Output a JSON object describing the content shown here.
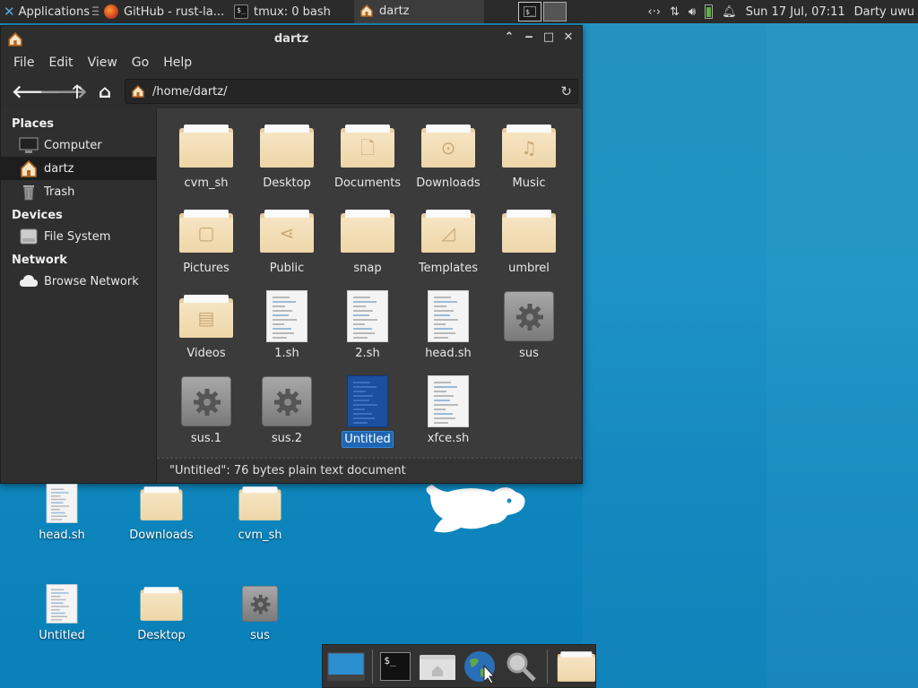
{
  "panel": {
    "apps_label": "Applications",
    "apps_sep": "☰",
    "tasks": [
      {
        "label": "GitHub - rust-la..."
      },
      {
        "label": "tmux: 0 bash"
      },
      {
        "label": "dartz"
      }
    ],
    "term_glyph": "$_",
    "clock": "Sun 17 Jul, 07:11",
    "user": "Darty uwu"
  },
  "window": {
    "title": "dartz",
    "menu": [
      "File",
      "Edit",
      "View",
      "Go",
      "Help"
    ],
    "path": "/home/dartz/",
    "sidebar": {
      "places_header": "Places",
      "places": [
        {
          "label": "Computer",
          "icon": "computer-icon"
        },
        {
          "label": "dartz",
          "icon": "home-icon"
        },
        {
          "label": "Trash",
          "icon": "trash-icon"
        }
      ],
      "devices_header": "Devices",
      "devices": [
        {
          "label": "File System",
          "icon": "drive-icon"
        }
      ],
      "network_header": "Network",
      "network": [
        {
          "label": "Browse Network",
          "icon": "cloud-icon"
        }
      ]
    },
    "files": [
      {
        "name": "cvm_sh",
        "type": "folder"
      },
      {
        "name": "Desktop",
        "type": "folder"
      },
      {
        "name": "Documents",
        "type": "folder",
        "emblem": "document"
      },
      {
        "name": "Downloads",
        "type": "folder",
        "emblem": "download"
      },
      {
        "name": "Music",
        "type": "folder",
        "emblem": "music"
      },
      {
        "name": "Pictures",
        "type": "folder",
        "emblem": "picture"
      },
      {
        "name": "Public",
        "type": "folder",
        "emblem": "share"
      },
      {
        "name": "snap",
        "type": "folder"
      },
      {
        "name": "Templates",
        "type": "folder",
        "emblem": "template"
      },
      {
        "name": "umbrel",
        "type": "folder"
      },
      {
        "name": "Videos",
        "type": "folder",
        "emblem": "video"
      },
      {
        "name": "1.sh",
        "type": "script"
      },
      {
        "name": "2.sh",
        "type": "script"
      },
      {
        "name": "head.sh",
        "type": "script"
      },
      {
        "name": "sus",
        "type": "executable"
      },
      {
        "name": "sus.1",
        "type": "executable"
      },
      {
        "name": "sus.2",
        "type": "executable"
      },
      {
        "name": "Untitled",
        "type": "text",
        "selected": true
      },
      {
        "name": "xfce.sh",
        "type": "script"
      }
    ],
    "status": "\"Untitled\": 76 bytes plain text document"
  },
  "desktop": {
    "icons": [
      {
        "name": "head.sh",
        "type": "script"
      },
      {
        "name": "Downloads",
        "type": "folder"
      },
      {
        "name": "cvm_sh",
        "type": "folder"
      },
      {
        "name": "Untitled",
        "type": "text"
      },
      {
        "name": "Desktop",
        "type": "folder"
      },
      {
        "name": "sus",
        "type": "executable"
      }
    ]
  },
  "dock": {
    "items": [
      {
        "name": "show-desktop",
        "icon": "desktop-icon"
      },
      {
        "name": "terminal",
        "icon": "terminal-icon",
        "glyph": "$_"
      },
      {
        "name": "file-manager",
        "icon": "home-folder-icon"
      },
      {
        "name": "web-browser",
        "icon": "globe-icon"
      },
      {
        "name": "app-finder",
        "icon": "magnifier-icon"
      },
      {
        "name": "folder",
        "icon": "folder-icon"
      }
    ]
  }
}
